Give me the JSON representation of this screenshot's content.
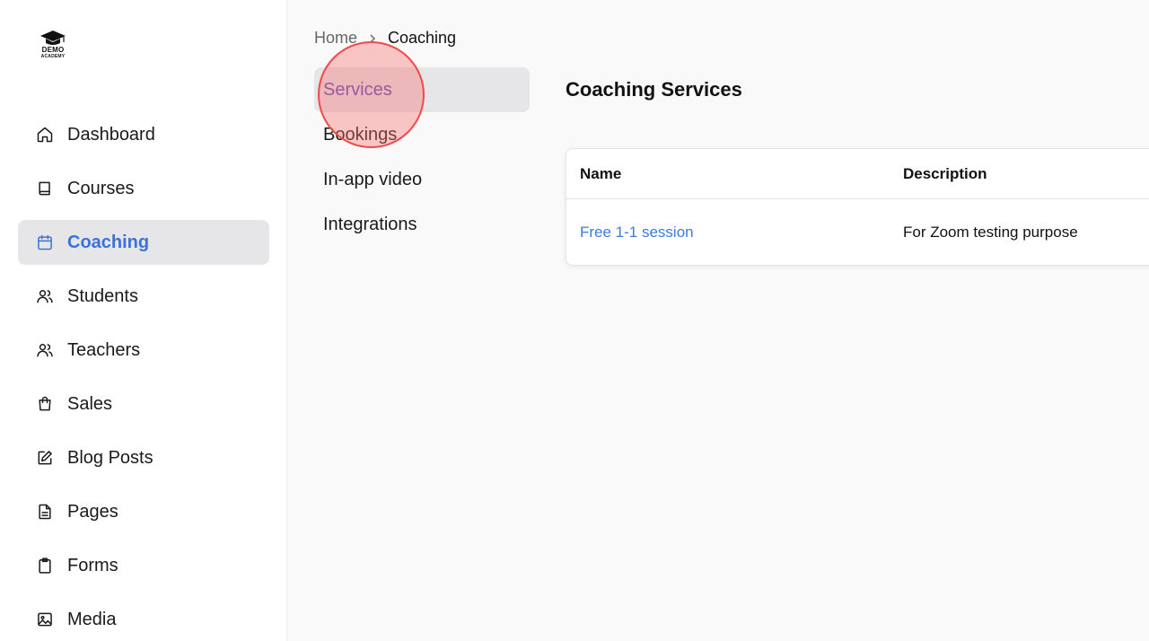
{
  "logo": {
    "line1": "DEMO",
    "line2": "ACADEMY"
  },
  "sidebar": {
    "items": [
      {
        "label": "Dashboard",
        "icon": "home-icon",
        "active": false
      },
      {
        "label": "Courses",
        "icon": "book-icon",
        "active": false
      },
      {
        "label": "Coaching",
        "icon": "calendar-icon",
        "active": true
      },
      {
        "label": "Students",
        "icon": "users-icon",
        "active": false
      },
      {
        "label": "Teachers",
        "icon": "users-icon",
        "active": false
      },
      {
        "label": "Sales",
        "icon": "shopping-bag-icon",
        "active": false
      },
      {
        "label": "Blog Posts",
        "icon": "edit-icon",
        "active": false
      },
      {
        "label": "Pages",
        "icon": "file-text-icon",
        "active": false
      },
      {
        "label": "Forms",
        "icon": "clipboard-icon",
        "active": false
      },
      {
        "label": "Media",
        "icon": "image-icon",
        "active": false
      }
    ]
  },
  "breadcrumb": {
    "home": "Home",
    "current": "Coaching"
  },
  "subnav": {
    "items": [
      {
        "label": "Services",
        "active": true
      },
      {
        "label": "Bookings",
        "active": false
      },
      {
        "label": "In-app video",
        "active": false
      },
      {
        "label": "Integrations",
        "active": false
      }
    ]
  },
  "main": {
    "title": "Coaching Services",
    "table": {
      "headers": [
        "Name",
        "Description"
      ],
      "rows": [
        {
          "name": "Free 1-1 session",
          "description": "For Zoom testing purpose"
        }
      ]
    }
  },
  "colors": {
    "accent": "#3b72d9",
    "link": "#3b7be0",
    "active_bg": "#e6e6e8",
    "click_marker": "#ef4a4a"
  }
}
